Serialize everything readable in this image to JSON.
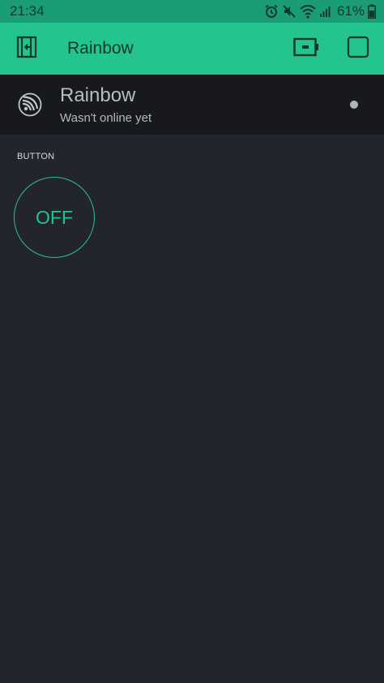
{
  "status_bar": {
    "time": "21:34",
    "battery_percent": "61%",
    "icons": [
      "alarm-icon",
      "mute-icon",
      "wifi-icon",
      "signal-icon",
      "battery-icon"
    ]
  },
  "app_bar": {
    "title": "Rainbow",
    "left_icon": "exit-icon",
    "right_icons": [
      "device-battery-icon",
      "play-square-icon"
    ],
    "background_color": "#23c48e"
  },
  "device": {
    "name": "Rainbow",
    "status": "Wasn't online yet",
    "icon": "esp-chip-icon"
  },
  "widgets": [
    {
      "label": "BUTTON",
      "state": "OFF",
      "accent_color": "#23c48e"
    }
  ]
}
